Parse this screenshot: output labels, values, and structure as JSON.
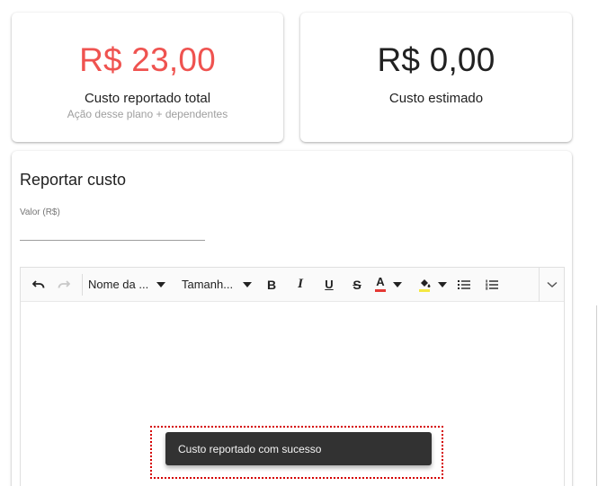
{
  "stats": {
    "reported": {
      "value": "R$ 23,00",
      "label": "Custo reportado total",
      "sublabel": "Ação desse plano + dependentes",
      "value_color": "#ef5350"
    },
    "estimated": {
      "value": "R$ 0,00",
      "label": "Custo estimado"
    }
  },
  "form": {
    "title": "Reportar custo",
    "value_field": {
      "label": "Valor (R$)",
      "value": "",
      "placeholder": ""
    }
  },
  "editor": {
    "toolbar": {
      "font_name": "Nome da ...",
      "font_size": "Tamanh...",
      "bold": "B",
      "italic": "I",
      "underline": "U",
      "strike": "S",
      "font_color_letter": "A"
    },
    "icons": [
      "undo-icon",
      "redo-icon",
      "bold-icon",
      "italic-icon",
      "underline-icon",
      "strikethrough-icon",
      "font-color-icon",
      "highlight-color-icon",
      "bullet-list-icon",
      "numbered-list-icon",
      "chevron-down-icon"
    ]
  },
  "snackbar": {
    "message": "Custo reportado com sucesso"
  }
}
